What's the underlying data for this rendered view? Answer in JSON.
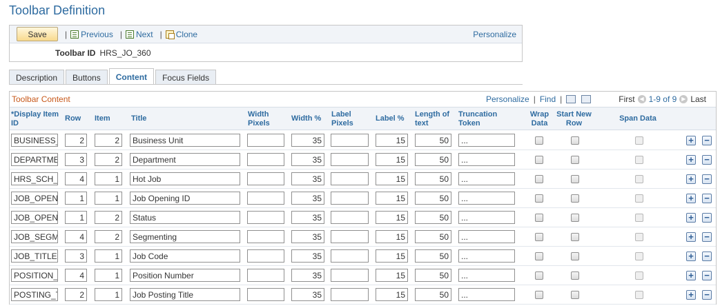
{
  "page": {
    "title": "Toolbar Definition"
  },
  "toolbar": {
    "save_label": "Save",
    "previous_label": "Previous",
    "next_label": "Next",
    "clone_label": "Clone",
    "personalize_label": "Personalize",
    "toolbar_id_label": "Toolbar ID",
    "toolbar_id_value": "HRS_JO_360"
  },
  "tabs": [
    {
      "label": "Description",
      "active": false
    },
    {
      "label": "Buttons",
      "active": false
    },
    {
      "label": "Content",
      "active": true
    },
    {
      "label": "Focus Fields",
      "active": false
    }
  ],
  "grid": {
    "title": "Toolbar Content",
    "personalize_label": "Personalize",
    "find_label": "Find",
    "first_label": "First",
    "range_label": "1-9 of 9",
    "last_label": "Last",
    "columns": {
      "display_item_id": "*Display Item ID",
      "row": "Row",
      "item": "Item",
      "title": "Title",
      "width_pixels": "Width Pixels",
      "width_pct": "Width %",
      "label_pixels": "Label Pixels",
      "label_pct": "Label %",
      "length_of_text": "Length of text",
      "truncation_token": "Truncation Token",
      "wrap_data": "Wrap Data",
      "start_new_row": "Start New Row",
      "span_data": "Span Data"
    },
    "rows": [
      {
        "id": "BUSINESS_",
        "row": "2",
        "item": "2",
        "title": "Business Unit",
        "width_pixels": "",
        "width_pct": "35",
        "label_pixels": "",
        "label_pct": "15",
        "length": "50",
        "token": "..."
      },
      {
        "id": "DEPARTME",
        "row": "3",
        "item": "2",
        "title": "Department",
        "width_pixels": "",
        "width_pct": "35",
        "label_pixels": "",
        "label_pct": "15",
        "length": "50",
        "token": "..."
      },
      {
        "id": "HRS_SCH_",
        "row": "4",
        "item": "1",
        "title": "Hot Job",
        "width_pixels": "",
        "width_pct": "35",
        "label_pixels": "",
        "label_pct": "15",
        "length": "50",
        "token": "..."
      },
      {
        "id": "JOB_OPEN",
        "row": "1",
        "item": "1",
        "title": "Job Opening ID",
        "width_pixels": "",
        "width_pct": "35",
        "label_pixels": "",
        "label_pct": "15",
        "length": "50",
        "token": "..."
      },
      {
        "id": "JOB_OPEN",
        "row": "1",
        "item": "2",
        "title": "Status",
        "width_pixels": "",
        "width_pct": "35",
        "label_pixels": "",
        "label_pct": "15",
        "length": "50",
        "token": "..."
      },
      {
        "id": "JOB_SEGM",
        "row": "4",
        "item": "2",
        "title": "Segmenting",
        "width_pixels": "",
        "width_pct": "35",
        "label_pixels": "",
        "label_pct": "15",
        "length": "50",
        "token": "..."
      },
      {
        "id": "JOB_TITLE",
        "row": "3",
        "item": "1",
        "title": "Job Code",
        "width_pixels": "",
        "width_pct": "35",
        "label_pixels": "",
        "label_pct": "15",
        "length": "50",
        "token": "..."
      },
      {
        "id": "POSITION_",
        "row": "4",
        "item": "1",
        "title": "Position Number",
        "width_pixels": "",
        "width_pct": "35",
        "label_pixels": "",
        "label_pct": "15",
        "length": "50",
        "token": "..."
      },
      {
        "id": "POSTING_T",
        "row": "2",
        "item": "1",
        "title": "Job Posting Title",
        "width_pixels": "",
        "width_pct": "35",
        "label_pixels": "",
        "label_pct": "15",
        "length": "50",
        "token": "..."
      }
    ],
    "add_row_symbol": "+",
    "delete_row_symbol": "−"
  }
}
